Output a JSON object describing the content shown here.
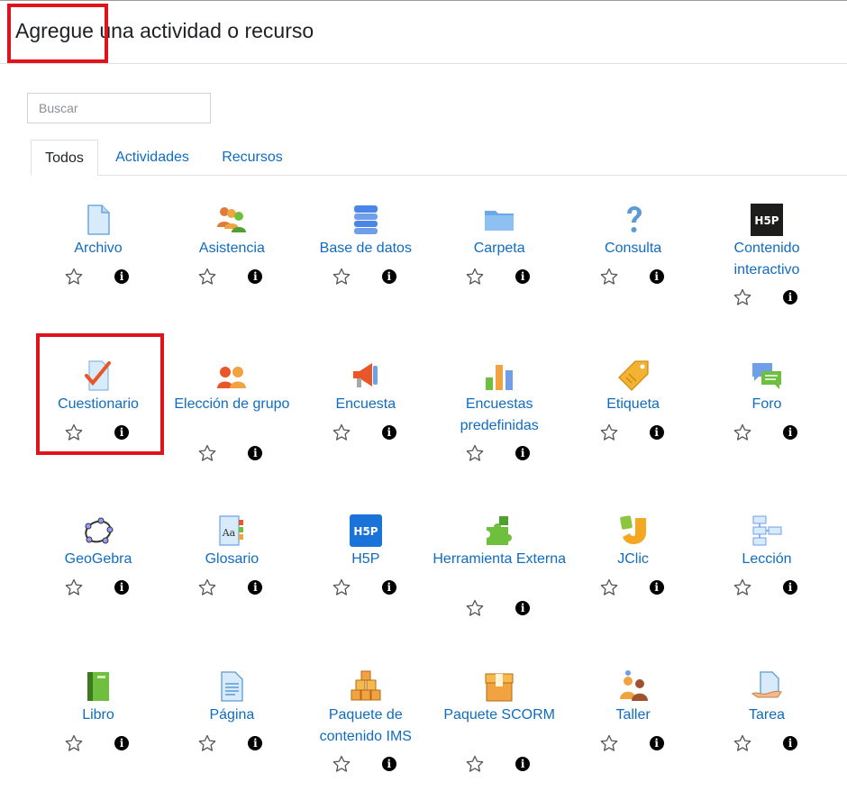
{
  "modal": {
    "title": "Agregue una actividad o recurso"
  },
  "search": {
    "placeholder": "Buscar"
  },
  "tabs": [
    {
      "label": "Todos"
    },
    {
      "label": "Actividades"
    },
    {
      "label": "Recursos"
    }
  ],
  "items": [
    {
      "name": "Archivo",
      "icon": "file-icon"
    },
    {
      "name": "Asistencia",
      "icon": "attendance-icon"
    },
    {
      "name": "Base de datos",
      "icon": "database-icon"
    },
    {
      "name": "Carpeta",
      "icon": "folder-icon"
    },
    {
      "name": "Consulta",
      "icon": "question-icon"
    },
    {
      "name": "Contenido interactivo",
      "icon": "h5p-dark-icon"
    },
    {
      "name": "Cuestionario",
      "icon": "quiz-icon"
    },
    {
      "name": "Elección de grupo",
      "icon": "group-choice-icon"
    },
    {
      "name": "Encuesta",
      "icon": "megaphone-icon"
    },
    {
      "name": "Encuestas predefinidas",
      "icon": "survey-chart-icon"
    },
    {
      "name": "Etiqueta",
      "icon": "label-tag-icon"
    },
    {
      "name": "Foro",
      "icon": "forum-icon"
    },
    {
      "name": "GeoGebra",
      "icon": "geogebra-icon"
    },
    {
      "name": "Glosario",
      "icon": "glossary-icon"
    },
    {
      "name": "H5P",
      "icon": "h5p-icon"
    },
    {
      "name": "Herramienta Externa",
      "icon": "puzzle-icon"
    },
    {
      "name": "JClic",
      "icon": "jclic-icon"
    },
    {
      "name": "Lección",
      "icon": "lesson-icon"
    },
    {
      "name": "Libro",
      "icon": "book-icon"
    },
    {
      "name": "Página",
      "icon": "page-icon"
    },
    {
      "name": "Paquete de contenido IMS",
      "icon": "ims-package-icon"
    },
    {
      "name": "Paquete SCORM",
      "icon": "scorm-package-icon"
    },
    {
      "name": "Taller",
      "icon": "workshop-icon"
    },
    {
      "name": "Tarea",
      "icon": "assignment-icon"
    }
  ],
  "colors": {
    "link": "#0f6cbf",
    "highlight": "#e0121c"
  }
}
